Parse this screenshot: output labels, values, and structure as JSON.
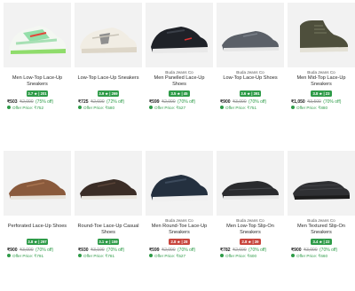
{
  "products": [
    {
      "brand": "",
      "title": "Men Low-Top Lace-Up Sneakers",
      "rating": "3.7 ★ | 201",
      "rating_color": "green",
      "sell": "₹503",
      "mrp": "₹2,000",
      "disc": "(75% off)",
      "offer": "Offer Price: ₹752",
      "shoe": "sneaker-green-white"
    },
    {
      "brand": "",
      "title": "Low-Top Lace-Up Sneakers",
      "rating": "3.9 ★ | 269",
      "rating_color": "green",
      "sell": "₹725",
      "mrp": "₹2,600",
      "disc": "(72% off)",
      "offer": "Offer Price: ₹580",
      "shoe": "sneaker-white-grey"
    },
    {
      "brand": "Buda Jeans Co",
      "title": "Men Panelled Lace-Up Shoes",
      "rating": "3.5 ★ | 45",
      "rating_color": "green",
      "sell": "₹599",
      "mrp": "₹2,000",
      "disc": "(70% off)",
      "offer": "Offer Price: ₹527",
      "shoe": "sneaker-black"
    },
    {
      "brand": "Buda Jeans Co",
      "title": "Low-Top Lace-Up Shoes",
      "rating": "3.6 ★ | 391",
      "rating_color": "green",
      "sell": "₹900",
      "mrp": "₹3,000",
      "disc": "(70% off)",
      "offer": "Offer Price: ₹751",
      "shoe": "shoe-grey"
    },
    {
      "brand": "Buda Jeans Co",
      "title": "Men Mid-Top Lace-Up Sneakers",
      "rating": "3.8 ★ | 23",
      "rating_color": "green",
      "sell": "₹1,050",
      "mrp": "₹3,500",
      "disc": "(70% off)",
      "offer": "Offer Price: ₹880",
      "shoe": "midtop-olive"
    },
    {
      "brand": "",
      "title": "Perforated Lace-Up Shoes",
      "rating": "3.8 ★ | 297",
      "rating_color": "green",
      "sell": "₹900",
      "mrp": "₹3,000",
      "disc": "(70% off)",
      "offer": "Offer Price: ₹791",
      "shoe": "shoe-brown"
    },
    {
      "brand": "",
      "title": "Round-Toe Lace-Up Casual Shoes",
      "rating": "3.1 ★ | 159",
      "rating_color": "green",
      "sell": "₹930",
      "mrp": "₹3,100",
      "disc": "(70% off)",
      "offer": "Offer Price: ₹781",
      "shoe": "shoe-darkbrown"
    },
    {
      "brand": "Buda Jeans Co",
      "title": "Men Round-Toe Lace-Up Sneakers",
      "rating": "2.8 ★ | 28",
      "rating_color": "red",
      "sell": "₹599",
      "mrp": "₹2,000",
      "disc": "(70% off)",
      "offer": "Offer Price: ₹527",
      "shoe": "sneaker-navy"
    },
    {
      "brand": "Buda Jeans Co",
      "title": "Men Low-Top Slip-On Sneakers",
      "rating": "2.8 ★ | 39",
      "rating_color": "red",
      "sell": "₹782",
      "mrp": "₹2,600",
      "disc": "(70% off)",
      "offer": "Offer Price: ₹600",
      "shoe": "slipon-black"
    },
    {
      "brand": "Buda Jeans Co",
      "title": "Men Textured Slip-On Sneakers",
      "rating": "3.4 ★ | 22",
      "rating_color": "green",
      "sell": "₹900",
      "mrp": "₹3,000",
      "disc": "(70% off)",
      "offer": "Offer Price: ₹660",
      "shoe": "slipon-dark"
    }
  ]
}
